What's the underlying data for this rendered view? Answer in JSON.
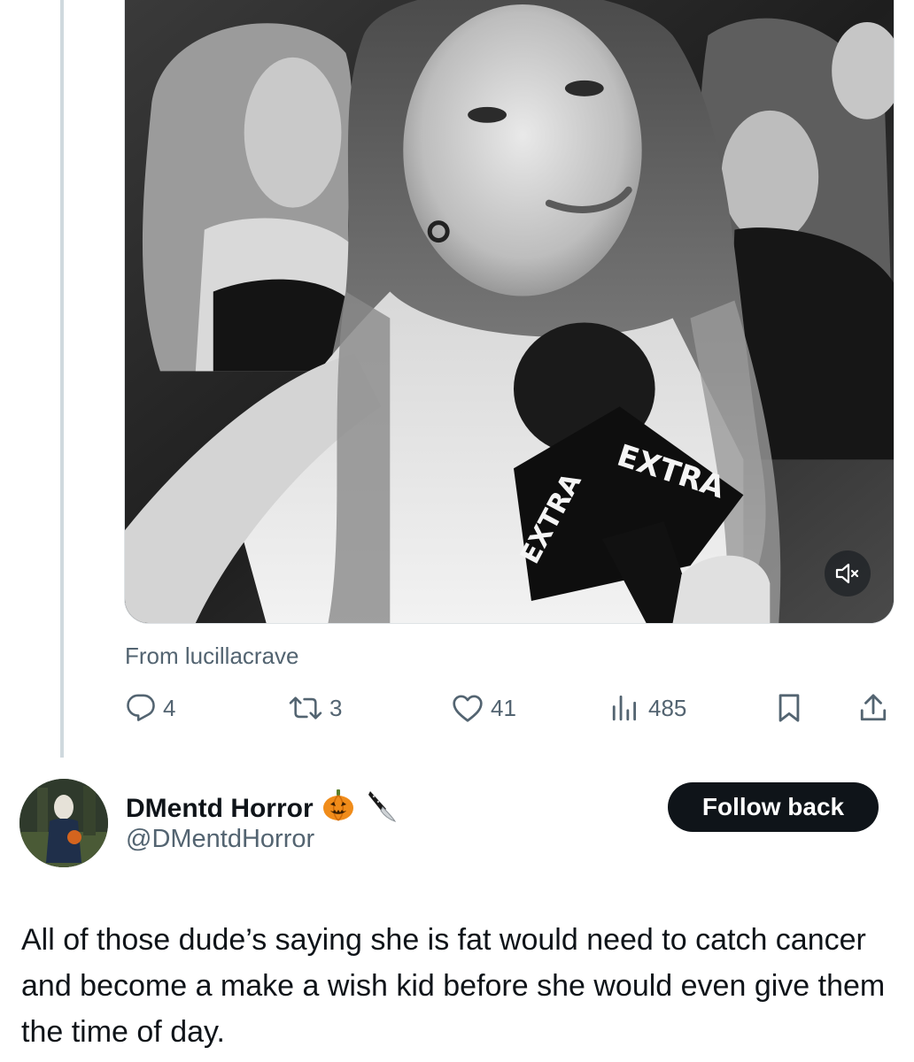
{
  "quoted_post": {
    "media": {
      "description_icon": "mute-icon",
      "mic_brand_text": "EXTRA"
    },
    "source_prefix": "From ",
    "source_account": "lucillacrave",
    "actions": {
      "reply_count": "4",
      "repost_count": "3",
      "like_count": "41",
      "view_count": "485"
    }
  },
  "reply": {
    "display_name": "DMentd Horror",
    "name_emojis": [
      "🎃",
      "🔪"
    ],
    "handle": "@DMentdHorror",
    "follow_label": "Follow back",
    "text": "All of those dude’s saying she is fat would need to catch cancer and become a make a wish kid before she would even give them the time of day."
  },
  "colors": {
    "text_primary": "#0f1419",
    "text_secondary": "#536471",
    "thread_line": "#cfd9de",
    "button_bg": "#0f1419"
  }
}
